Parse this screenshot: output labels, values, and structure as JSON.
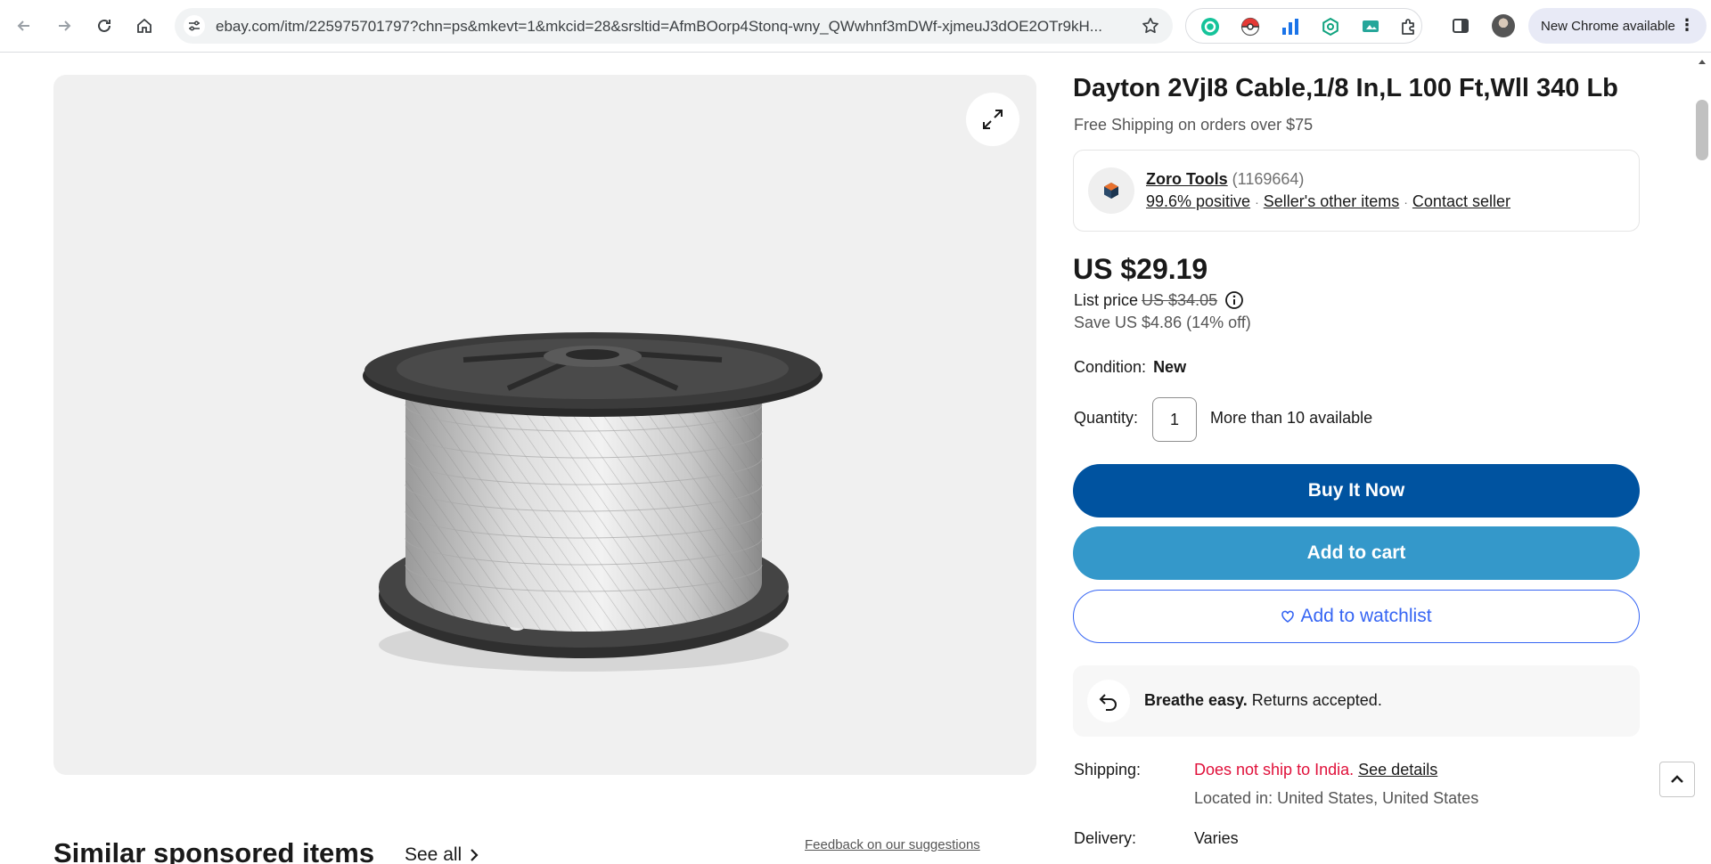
{
  "browser": {
    "url": "ebay.com/itm/225975701797?chn=ps&mkevt=1&mkcid=28&srsltid=AfmBOorp4Stonq-wny_QWwhnf3mDWf-xjmeuJ3dOE2OTr9kH...",
    "update_label": "New Chrome available",
    "extensions": [
      "grammarly-icon",
      "pokeball-icon",
      "analytics-icon",
      "ai-assistant-icon",
      "screen-capture-icon",
      "puzzle-extensions-icon"
    ]
  },
  "product": {
    "title": "Dayton 2VjI8 Cable,1/8 In,L 100 Ft,Wll 340 Lb",
    "shipping_promo": "Free Shipping on orders over $75"
  },
  "seller": {
    "name": "Zoro Tools",
    "feedback_count": "(1169664)",
    "positive": "99.6% positive",
    "other_items": "Seller's other items",
    "contact": "Contact seller"
  },
  "pricing": {
    "price": "US $29.19",
    "list_label": "List price",
    "list_value": "US $34.05",
    "savings": "Save US $4.86 (14% off)"
  },
  "condition": {
    "label": "Condition:",
    "value": "New"
  },
  "quantity": {
    "label": "Quantity:",
    "value": "1",
    "availability": "More than 10 available"
  },
  "actions": {
    "buy_now": "Buy It Now",
    "add_to_cart": "Add to cart",
    "watchlist": "Add to watchlist"
  },
  "returns": {
    "bold": "Breathe easy.",
    "text": " Returns accepted."
  },
  "shipping": {
    "label": "Shipping:",
    "warning": "Does not ship to India",
    "see_details": "See details",
    "location": "Located in: United States, United States"
  },
  "delivery": {
    "label": "Delivery:",
    "value": "Varies"
  },
  "similar": {
    "heading": "Similar sponsored items",
    "see_all": "See all",
    "feedback": "Feedback on our suggestions"
  },
  "colors": {
    "buy_now": "#0053a0",
    "add_to_cart": "#3498ca",
    "watchlist": "#3665f3",
    "shipping_warning": "#e0103a"
  }
}
